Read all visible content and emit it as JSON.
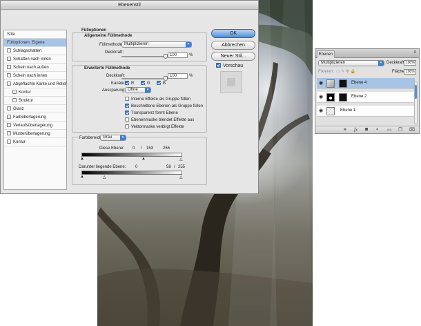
{
  "dialog": {
    "title": "Ebenenstil",
    "sidebar": {
      "items": [
        {
          "label": "Stile",
          "checkbox": false,
          "checked": false,
          "selected": false,
          "indent": false
        },
        {
          "label": "Fülloptionen: Eigene",
          "checkbox": false,
          "checked": false,
          "selected": true,
          "indent": false
        },
        {
          "label": "Schlagschatten",
          "checkbox": true,
          "checked": false,
          "selected": false,
          "indent": false
        },
        {
          "label": "Schatten nach innen",
          "checkbox": true,
          "checked": false,
          "selected": false,
          "indent": false
        },
        {
          "label": "Schein nach außen",
          "checkbox": true,
          "checked": false,
          "selected": false,
          "indent": false
        },
        {
          "label": "Schein nach innen",
          "checkbox": true,
          "checked": false,
          "selected": false,
          "indent": false
        },
        {
          "label": "Abgeflachte Kante und Relief",
          "checkbox": true,
          "checked": false,
          "selected": false,
          "indent": false
        },
        {
          "label": "Kontur",
          "checkbox": true,
          "checked": false,
          "selected": false,
          "indent": true
        },
        {
          "label": "Struktur",
          "checkbox": true,
          "checked": false,
          "selected": false,
          "indent": true
        },
        {
          "label": "Glanz",
          "checkbox": true,
          "checked": false,
          "selected": false,
          "indent": false
        },
        {
          "label": "Farbüberlagerung",
          "checkbox": true,
          "checked": false,
          "selected": false,
          "indent": false
        },
        {
          "label": "Verlaufsüberlagerung",
          "checkbox": true,
          "checked": false,
          "selected": false,
          "indent": false
        },
        {
          "label": "Musterüberlagerung",
          "checkbox": true,
          "checked": false,
          "selected": false,
          "indent": false
        },
        {
          "label": "Kontur",
          "checkbox": true,
          "checked": false,
          "selected": false,
          "indent": false
        }
      ]
    },
    "fill_options": {
      "title": "Fülloptionen",
      "general": {
        "title": "Allgemeine Füllmethode",
        "blend_label": "Füllmethode:",
        "blend_value": "Multiplizieren",
        "opacity_label": "Deckkraft:",
        "opacity_value": "100",
        "opacity_fraction": 1.0,
        "pct": "%"
      },
      "advanced": {
        "title": "Erweiterte Füllmethode",
        "fill_opacity_label": "Deckkraft:",
        "fill_opacity_value": "100",
        "fill_opacity_fraction": 1.0,
        "pct": "%",
        "channels_label": "Kanäle:",
        "channel_r": "R",
        "channel_g": "G",
        "channel_b": "B",
        "knockout_label": "Aussparung:",
        "knockout_value": "Ohne",
        "options": [
          {
            "label": "Interne Effekte als Gruppe füllen",
            "checked": false
          },
          {
            "label": "Beschnittene Ebenen als Gruppe füllen",
            "checked": true
          },
          {
            "label": "Transparenz formt Ebene",
            "checked": true
          },
          {
            "label": "Ebenenmaske blendet Effekte aus",
            "checked": false
          },
          {
            "label": "Vektormaske verbirgt Effekte",
            "checked": false
          }
        ]
      },
      "blend_if": {
        "label": "Farbbereich:",
        "value": "Grau",
        "this_layer_label": "Diese Ebene:",
        "this_layer_low": "0",
        "this_layer_sep": "/",
        "this_layer_mid": "153",
        "this_layer_high": "255",
        "underlying_label": "Darunter liegende Ebene:",
        "underlying_low": "0",
        "underlying_mid": "58",
        "underlying_sep": "/",
        "underlying_high": "255"
      }
    },
    "buttons": {
      "ok": "OK",
      "cancel": "Abbrechen",
      "new_style": "Neuer Stil...",
      "preview_label": "Vorschau",
      "preview_checked": true
    }
  },
  "layers_panel": {
    "tab": "Ebenen",
    "blend_value": "Multiplizieren",
    "opacity_label": "Deckkraft:",
    "opacity_value": "100%",
    "lock_label": "Fixieren:",
    "fill_label": "Fläche:",
    "fill_value": "100%",
    "layers": [
      {
        "name": "Ebene 4",
        "selected": true
      },
      {
        "name": "Ebene 2",
        "selected": false
      },
      {
        "name": "Ebene 1",
        "selected": false
      }
    ],
    "bottom_icons": [
      "link-icon",
      "fx-icon",
      "mask-icon",
      "adjustment-icon",
      "folder-icon",
      "new-layer-icon",
      "trash-icon"
    ]
  },
  "colors": {
    "accent": "#3a7fd0",
    "selection": "#a7c4e6",
    "dialog_bg": "#e6e6e6"
  }
}
